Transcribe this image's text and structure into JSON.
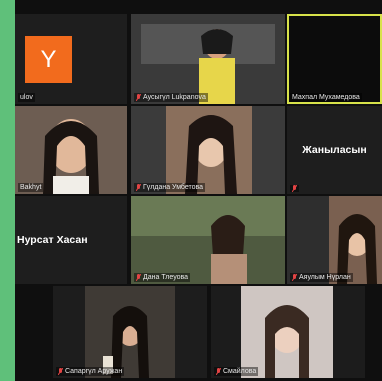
{
  "participants": [
    {
      "name": "ulov",
      "big": "",
      "initial": "Y"
    },
    {
      "name": "Аусыгүл Lukpanova",
      "big": ""
    },
    {
      "name": "Махпал Мухамедова",
      "big": ""
    },
    {
      "name": "Bakhyt",
      "big": ""
    },
    {
      "name": "Гүлдана Умбетова",
      "big": ""
    },
    {
      "name": "",
      "big": "Жаныласын"
    },
    {
      "name": "",
      "big": "Нурсат Хасан"
    },
    {
      "name": "Дана Тлеуова",
      "big": ""
    },
    {
      "name": "Аяулым Нүрлан",
      "big": ""
    },
    {
      "name": "Сапаргүл Аружан",
      "big": ""
    },
    {
      "name": "Смайлова",
      "big": ""
    }
  ],
  "colors": {
    "accent": "#5fc07a",
    "speaker_border": "#d7e24a",
    "avatar": "#f26b1d"
  },
  "icons": {
    "muted": "mic-muted-icon"
  }
}
